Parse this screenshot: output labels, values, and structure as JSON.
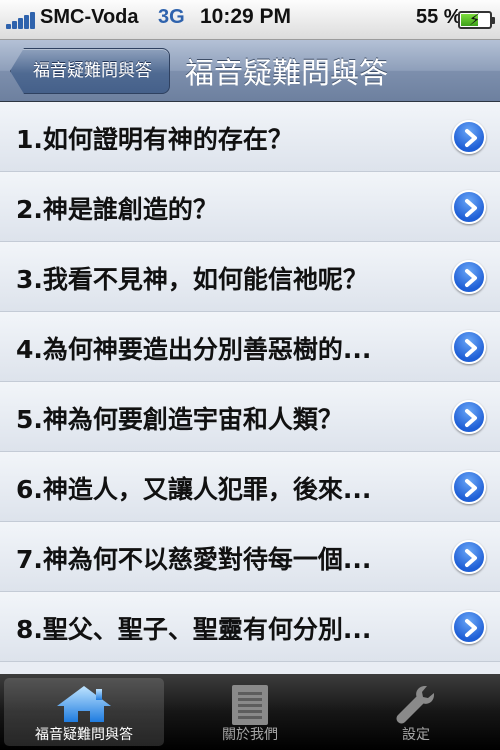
{
  "status_bar": {
    "carrier": "SMC-Voda",
    "network": "3G",
    "time": "10:29 PM",
    "battery_text": "55 %",
    "battery_level": 0.55
  },
  "nav_bar": {
    "back_label": "福音疑難問與答",
    "title": "福音疑難問與答"
  },
  "list": {
    "items": [
      "1.如何證明有神的存在？",
      "2.神是誰創造的？",
      "3.我看不見神，如何能信祂呢？",
      "4.為何神要造出分別善惡樹的...",
      "5.神為何要創造宇宙和人類？",
      "6.神造人，又讓人犯罪，後來...",
      "7.神為何不以慈愛對待每一個...",
      "8.聖父、聖子、聖靈有何分別..."
    ]
  },
  "tab_bar": {
    "tabs": [
      {
        "label": "福音疑難問與答",
        "icon": "home-icon",
        "active": true
      },
      {
        "label": "關於我們",
        "icon": "document-icon",
        "active": false
      },
      {
        "label": "設定",
        "icon": "wrench-icon",
        "active": false
      }
    ]
  },
  "colors": {
    "nav_bar": "#8e9fba",
    "disclosure_blue": "#1f5fd6",
    "network_blue": "#2f63ad"
  }
}
